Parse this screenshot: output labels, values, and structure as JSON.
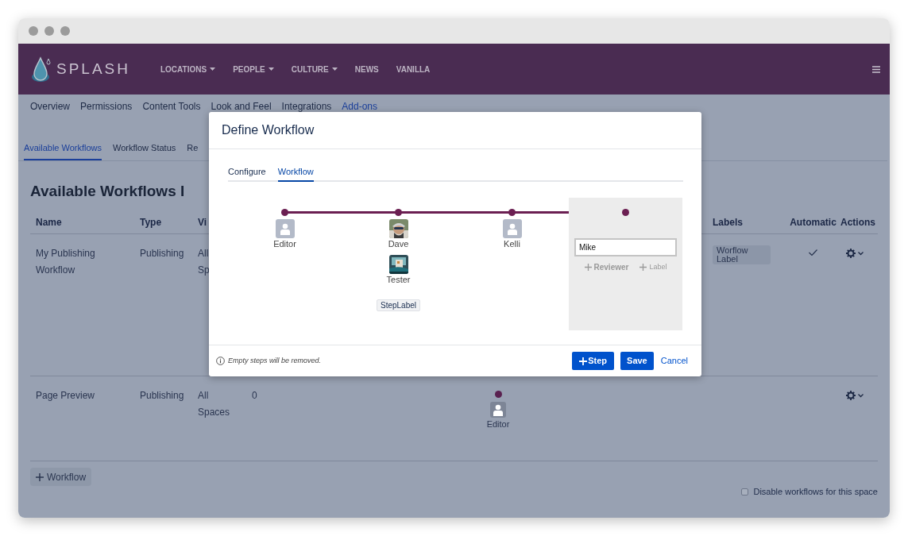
{
  "header": {
    "logo": "SPLASH",
    "nav": [
      {
        "label": "LOCATIONS",
        "dropdown": true
      },
      {
        "label": "PEOPLE",
        "dropdown": true
      },
      {
        "label": "CULTURE",
        "dropdown": true
      },
      {
        "label": "NEWS",
        "dropdown": false
      },
      {
        "label": "VANILLA",
        "dropdown": false
      }
    ]
  },
  "space_tabs": [
    {
      "label": "Overview",
      "selected": false
    },
    {
      "label": "Permissions",
      "selected": false
    },
    {
      "label": "Content Tools",
      "selected": false
    },
    {
      "label": "Look and Feel",
      "selected": false
    },
    {
      "label": "Integrations",
      "selected": false
    },
    {
      "label": "Add-ons",
      "selected": true
    }
  ],
  "sub_tabs": [
    {
      "label": "Available Workflows",
      "selected": true
    },
    {
      "label": "Workflow Status",
      "selected": false
    },
    {
      "label": "Re",
      "selected": false
    }
  ],
  "heading": "Available Workflows I",
  "table": {
    "columns": [
      "Name",
      "Type",
      "Vi",
      "Labels",
      "Automatic",
      "Actions"
    ],
    "rows": [
      {
        "name": "My Publishing Workflow",
        "type": "Publishing",
        "visibility": "All Sp",
        "labels": [
          "Worflow Label"
        ],
        "automatic": true
      },
      {
        "name": "Page Preview",
        "type": "Publishing",
        "visibility": "All Spaces",
        "count": "0",
        "steps": [
          {
            "reviewer": "Editor"
          }
        ],
        "automatic": false
      }
    ]
  },
  "add_workflow": "Workflow",
  "disable": {
    "label": "Disable workflows for this space",
    "checked": false
  },
  "modal": {
    "title": "Define Workflow",
    "tabs": [
      {
        "label": "Configure",
        "selected": false
      },
      {
        "label": "Workflow",
        "selected": true
      }
    ],
    "steps": [
      {
        "reviewers": [
          {
            "name": "Editor",
            "kind": "placeholder"
          }
        ],
        "selected": false
      },
      {
        "reviewers": [
          {
            "name": "Dave"
          },
          {
            "name": "Tester"
          }
        ],
        "label": "StepLabel",
        "selected": false
      },
      {
        "reviewers": [
          {
            "name": "Kelli",
            "kind": "placeholder"
          }
        ],
        "selected": false
      },
      {
        "selected": true,
        "input": "Mike",
        "actions": [
          "Reviewer",
          "Label"
        ]
      }
    ],
    "note": "Empty steps will be removed.",
    "buttons": [
      {
        "label": "Step",
        "kind": "add"
      },
      {
        "label": "Save",
        "kind": "primary"
      },
      {
        "label": "Cancel",
        "kind": "link"
      }
    ]
  }
}
